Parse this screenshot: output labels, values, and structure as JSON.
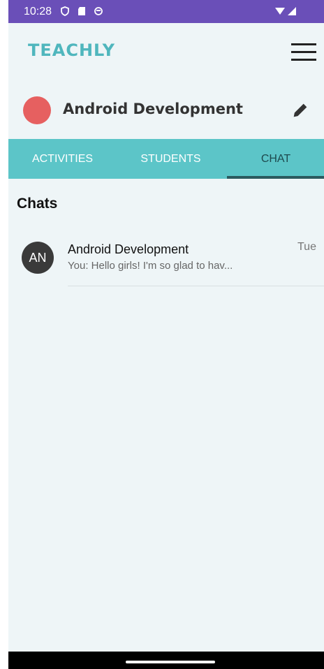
{
  "status_bar": {
    "time": "10:28"
  },
  "app": {
    "brand": "TEACHLY"
  },
  "course": {
    "title": "Android Development",
    "dot_color": "#e66060"
  },
  "tabs": [
    {
      "label": "ACTIVITIES",
      "active": false
    },
    {
      "label": "STUDENTS",
      "active": false
    },
    {
      "label": "CHAT",
      "active": true
    }
  ],
  "chats": {
    "section_title": "Chats",
    "items": [
      {
        "initials": "AN",
        "name": "Android Development",
        "preview": "You: Hello girls! I'm so glad to hav...",
        "time": "Tue"
      }
    ]
  },
  "colors": {
    "status_bar": "#6a4fb8",
    "brand": "#4fb6bd",
    "tab_bar": "#5cc5c8",
    "background": "#eef5f7"
  }
}
